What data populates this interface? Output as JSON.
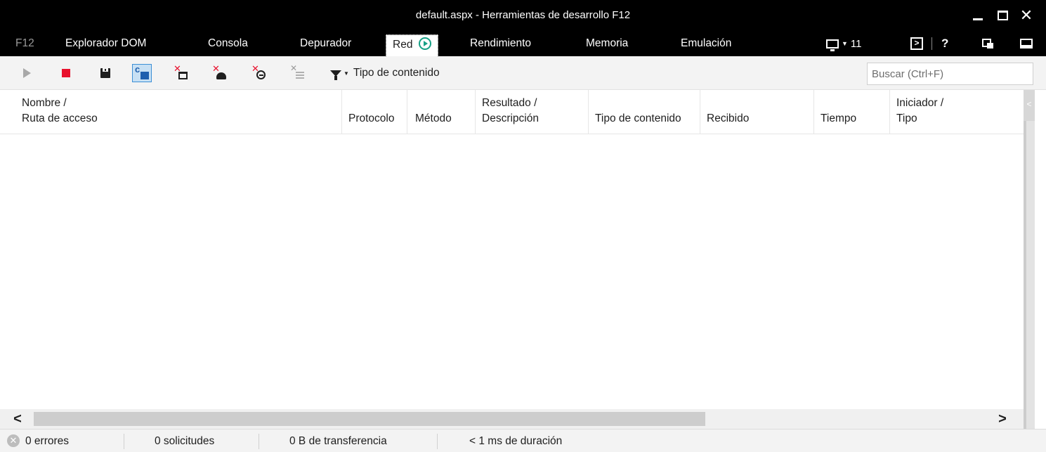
{
  "window": {
    "title": "default.aspx - Herramientas de desarrollo F12",
    "controls": {
      "minimize": "minimize-icon",
      "maximize": "maximize-icon",
      "close": "close-icon"
    }
  },
  "tabs": [
    {
      "label": "F12"
    },
    {
      "label": "Explorador DOM"
    },
    {
      "label": "Consola"
    },
    {
      "label": "Depurador"
    },
    {
      "label": "Red",
      "active": true
    },
    {
      "label": "Rendimiento"
    },
    {
      "label": "Memoria"
    },
    {
      "label": "Emulación"
    }
  ],
  "tab_right": {
    "target_count": "11",
    "icons": [
      "monitor-icon",
      "console-icon",
      "help-icon",
      "undock-icon",
      "dock-icon"
    ]
  },
  "toolbar": {
    "icons": [
      "play-icon",
      "stop-icon",
      "save-icon",
      "cache-icon",
      "clear-entries-icon",
      "clear-cookies-icon",
      "clear-cache-icon",
      "clear-list-icon",
      "filter-icon"
    ],
    "filter_label": "Tipo de contenido",
    "search_placeholder": "Buscar (Ctrl+F)"
  },
  "columns": [
    {
      "line1": "Nombre /",
      "line2": "Ruta de acceso"
    },
    {
      "line1": "",
      "line2": "Protocolo"
    },
    {
      "line1": "",
      "line2": "Método"
    },
    {
      "line1": "Resultado /",
      "line2": "Descripción"
    },
    {
      "line1": "",
      "line2": "Tipo de contenido"
    },
    {
      "line1": "",
      "line2": "Recibido"
    },
    {
      "line1": "",
      "line2": "Tiempo"
    },
    {
      "line1": "Iniciador /",
      "line2": "Tipo"
    }
  ],
  "rows": [],
  "status": {
    "errors": "0 errores",
    "requests": "0 solicitudes",
    "transferred": "0 B de transferencia",
    "duration": "< 1 ms de duración"
  },
  "colors": {
    "titlebar": "#000000",
    "accent": "#16a085",
    "stop": "#e8112d",
    "selected_button": "#c7e0f4"
  }
}
